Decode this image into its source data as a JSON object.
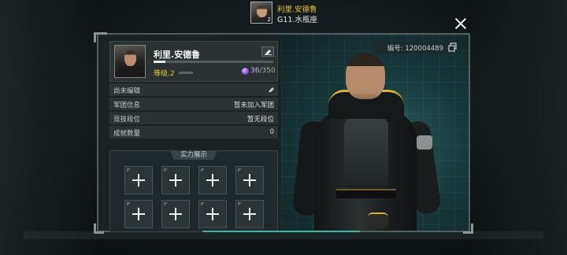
{
  "header": {
    "player_name": "利里.安德鲁",
    "avatar_level": "2",
    "server_sign": "G11.水瓶座"
  },
  "profile": {
    "name": "利里.安德鲁",
    "level_text": "等级.2",
    "xp_progress": 0.1,
    "energy_current": "36",
    "energy_max": "/350",
    "uid": "编号: 120004489"
  },
  "rows": [
    {
      "label": "尚未编辑",
      "value": ""
    },
    {
      "label": "军团信息",
      "value": "暂未加入军团"
    },
    {
      "label": "竞技段位",
      "value": "暂无段位"
    },
    {
      "label": "成就数量",
      "value": "0"
    }
  ],
  "showcase": {
    "title": "实力展示",
    "slot_count": 8
  },
  "colors": {
    "accent_gold": "#f1c232",
    "accent_teal": "#39b8a8",
    "energy_purple": "#7a3ad0"
  },
  "icons": [
    "close-icon",
    "edit-icon",
    "energy-orb-icon",
    "copy-icon",
    "add-slot-icon"
  ]
}
